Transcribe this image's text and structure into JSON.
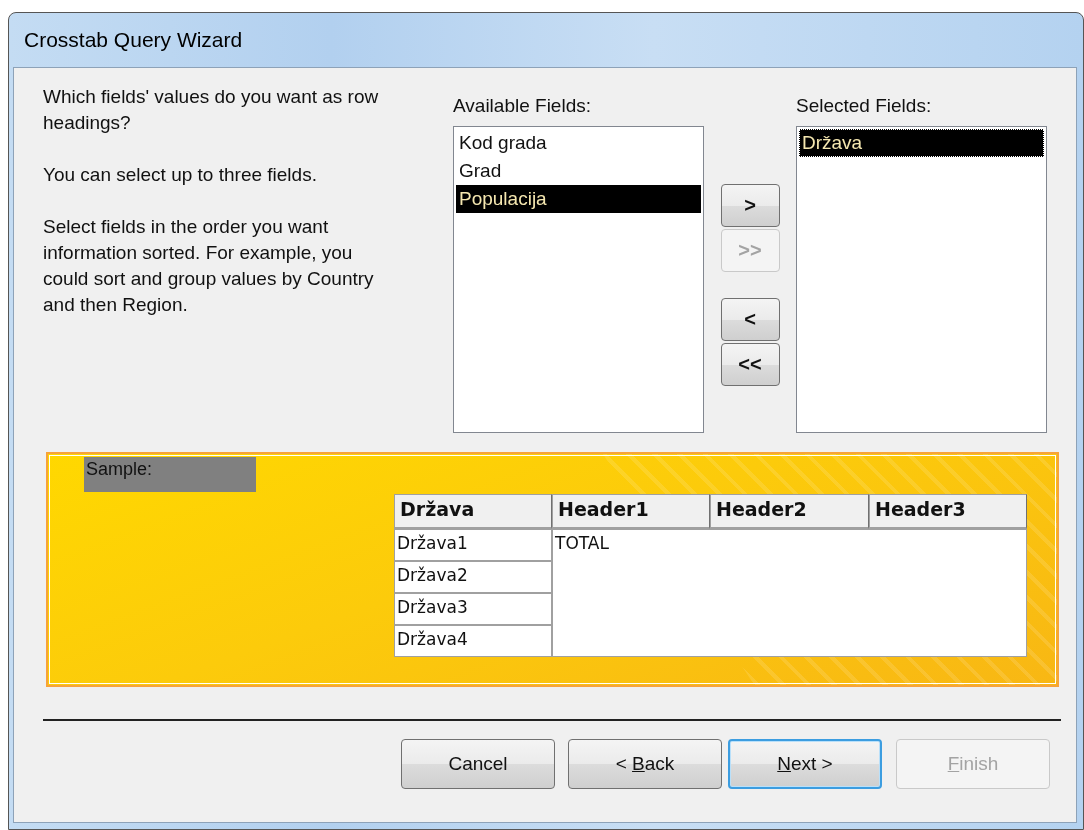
{
  "window": {
    "title": "Crosstab Query Wizard"
  },
  "instructions": [
    "Which fields' values do you want as row headings?",
    "You can select up to three fields.",
    "Select fields in the order you want information sorted.  For example, you could sort and group values by Country and then Region."
  ],
  "available_fields": {
    "label": "Available Fields:",
    "items": [
      {
        "label": "Kod grada",
        "selected": false,
        "focused": false
      },
      {
        "label": "Grad",
        "selected": false,
        "focused": false
      },
      {
        "label": "Populacija",
        "selected": true,
        "focused": false
      }
    ]
  },
  "move_buttons": [
    {
      "label": ">",
      "disabled": false
    },
    {
      "label": ">>",
      "disabled": true
    },
    {
      "label": "<",
      "disabled": false
    },
    {
      "label": "<<",
      "disabled": false
    }
  ],
  "selected_fields": {
    "label": "Selected Fields:",
    "items": [
      {
        "label": "Država",
        "selected": true,
        "focused": true
      }
    ]
  },
  "sample": {
    "label": "Sample:",
    "columns": [
      "Država",
      "Header1",
      "Header2",
      "Header3"
    ],
    "row_headings": [
      "Država1",
      "Država2",
      "Država3",
      "Država4"
    ],
    "value": "TOTAL"
  },
  "buttons": [
    {
      "after": "Cancel",
      "disabled": false,
      "default": false
    },
    {
      "before": "< ",
      "mnemonic": "B",
      "after": "ack",
      "disabled": false,
      "default": false
    },
    {
      "mnemonic": "N",
      "after": "ext >",
      "disabled": false,
      "default": true
    },
    {
      "mnemonic": "F",
      "after": "inish",
      "disabled": true,
      "default": false
    }
  ]
}
